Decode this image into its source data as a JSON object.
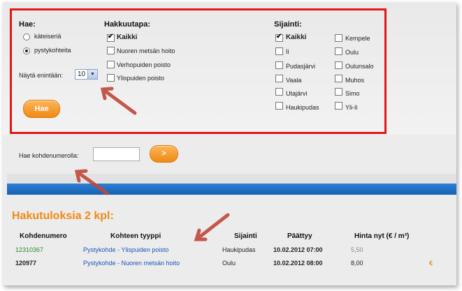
{
  "filters": {
    "search_type": {
      "label": "Hae:",
      "options": [
        {
          "label": "käteiseriä",
          "selected": false
        },
        {
          "label": "pystykohteita",
          "selected": true
        }
      ]
    },
    "show_max": {
      "label": "Näytä enintään:",
      "value": "10"
    },
    "search_button": "Hae",
    "harvest_method": {
      "label": "Hakkuutapa:",
      "options": [
        {
          "label": "Kaikki",
          "checked": true
        },
        {
          "label": "Nuoren metsän hoito",
          "checked": false
        },
        {
          "label": "Verhopuiden poisto",
          "checked": false
        },
        {
          "label": "Ylispuiden poisto",
          "checked": false
        }
      ]
    },
    "location": {
      "label": "Sijainti:",
      "col1": [
        {
          "label": "Kaikki",
          "checked": true
        },
        {
          "label": "Ii",
          "checked": false
        },
        {
          "label": "Pudasjärvi",
          "checked": false
        },
        {
          "label": "Vaala",
          "checked": false
        },
        {
          "label": "Utajärvi",
          "checked": false
        },
        {
          "label": "Haukipudas",
          "checked": false
        }
      ],
      "col2": [
        {
          "label": "Kempele",
          "checked": false
        },
        {
          "label": "Oulu",
          "checked": false
        },
        {
          "label": "Oulunsalo",
          "checked": false
        },
        {
          "label": "Muhos",
          "checked": false
        },
        {
          "label": "Simo",
          "checked": false
        },
        {
          "label": "Yli-Ii",
          "checked": false
        }
      ]
    }
  },
  "number_search": {
    "label": "Hae kohdenumerolla:",
    "value": "",
    "button": ">"
  },
  "results": {
    "title": "Hakutuloksia 2 kpl:",
    "columns": [
      "Kohdenumero",
      "Kohteen tyyppi",
      "Sijainti",
      "Päättyy",
      "Hinta nyt (€ / m³)"
    ],
    "rows": [
      {
        "id": "12310367",
        "type": "Pystykohde - Ylispuiden poisto",
        "location": "Haukipudas",
        "ends": "10.02.2012 07:00",
        "price": "5,50",
        "extra": ""
      },
      {
        "id": "120977",
        "type": "Pystykohde - Nuoren metsän hoito",
        "location": "Oulu",
        "ends": "10.02.2012 08:00",
        "price": "8,00",
        "extra": "€"
      }
    ]
  },
  "colors": {
    "highlight_border": "#e01818",
    "accent": "#f08a14",
    "bar": "#1561b4",
    "arrow": "#c0473a"
  }
}
